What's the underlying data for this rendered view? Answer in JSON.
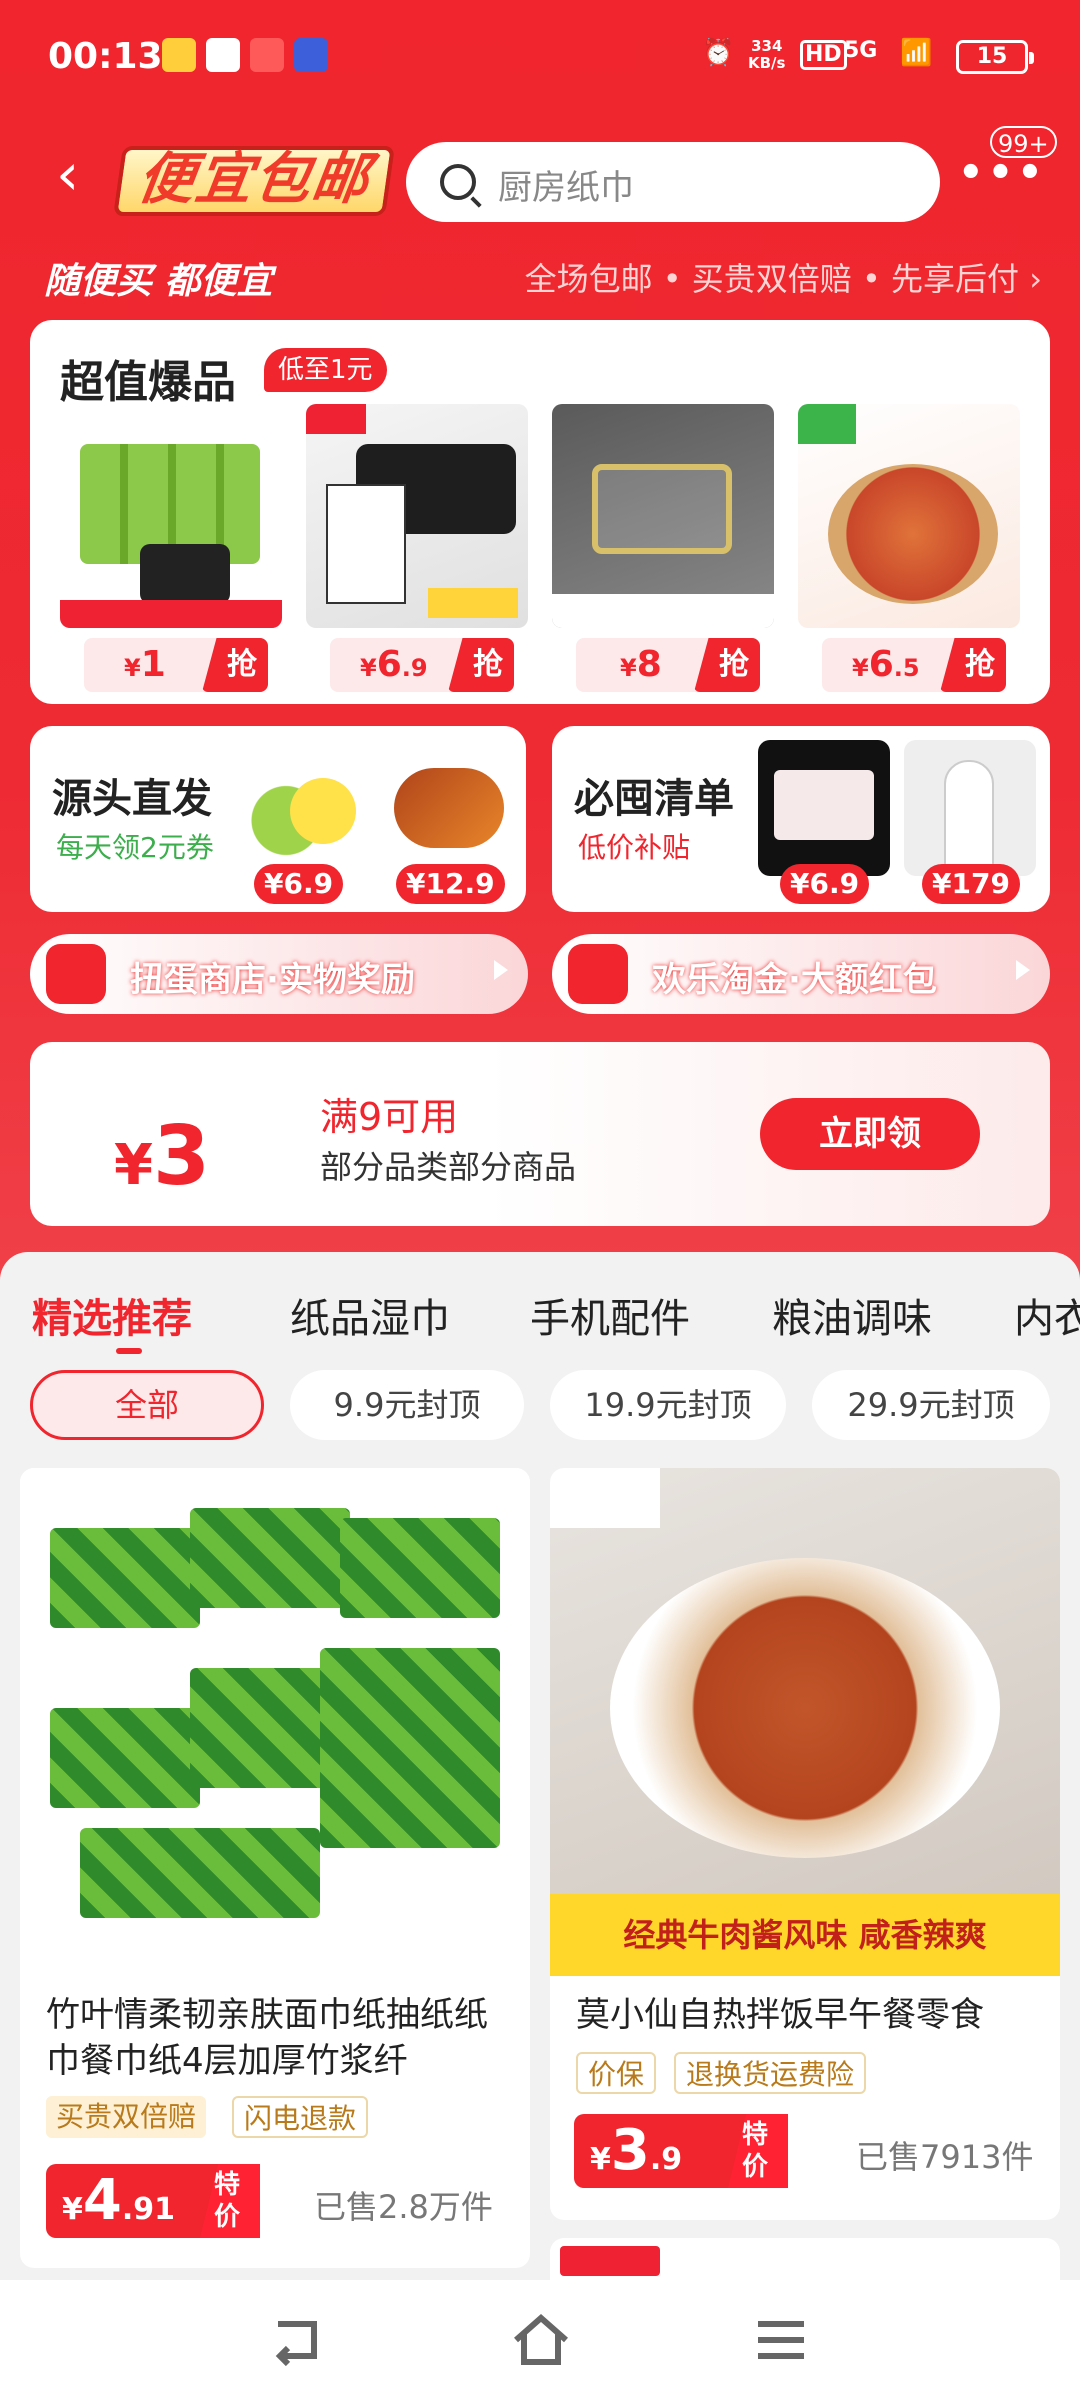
{
  "status_bar": {
    "time": "00:13",
    "net_speed_value": "334",
    "net_speed_unit": "KB/s",
    "hd": "HD",
    "network": "5G",
    "battery": "15"
  },
  "header": {
    "title": "便宜包邮",
    "search_placeholder": "厨房纸巾",
    "more_badge": "99+"
  },
  "banner": {
    "slogan": "随便买 都便宜",
    "features": "全场包邮 • 买贵双倍赔 • 先享后付 ›"
  },
  "hot": {
    "title": "超值爆品",
    "tag": "低至1元",
    "items": [
      {
        "currency": "¥",
        "price": "1",
        "cents": "",
        "action": "抢"
      },
      {
        "currency": "¥",
        "price": "6",
        "cents": ".9",
        "action": "抢"
      },
      {
        "currency": "¥",
        "price": "8",
        "cents": "",
        "action": "抢"
      },
      {
        "currency": "¥",
        "price": "6",
        "cents": ".5",
        "action": "抢"
      }
    ]
  },
  "source": {
    "title": "源头直发",
    "subtitle": "每天领2元券",
    "prices": [
      "¥6.9",
      "¥12.9"
    ]
  },
  "must": {
    "title": "必囤清单",
    "subtitle": "低价补贴",
    "prices": [
      "¥6.9",
      "¥179"
    ]
  },
  "pills": [
    {
      "label": "扭蛋商店·实物奖励"
    },
    {
      "label": "欢乐淘金·大额红包"
    }
  ],
  "coupon": {
    "currency": "¥",
    "amount": "3",
    "condition": "满9可用",
    "scope": "部分品类部分商品",
    "button": "立即领"
  },
  "tabs": [
    "精选推荐",
    "纸品湿巾",
    "手机配件",
    "粮油调味",
    "内衣"
  ],
  "filters": [
    "全部",
    "9.9元封顶",
    "19.9元封顶",
    "29.9元封顶"
  ],
  "goods": [
    {
      "title": "竹叶情柔韧亲肤面巾纸抽纸纸巾餐巾纸4层加厚竹浆纤",
      "tags": [
        "买贵双倍赔",
        "闪电退款"
      ],
      "currency": "¥",
      "price": "4",
      "cents": ".91",
      "special": "特价",
      "sold": "已售2.8万件"
    },
    {
      "title": "莫小仙自热拌饭早午餐零食",
      "tags": [
        "价保",
        "退换货运费险"
      ],
      "currency": "¥",
      "price": "3",
      "cents": ".9",
      "special": "特价",
      "sold": "已售7913件",
      "banner_text": "经典牛肉酱风味  咸香辣爽"
    }
  ],
  "colors": {
    "brand_red": "#f0252d",
    "light_pink": "#fde9ea"
  }
}
